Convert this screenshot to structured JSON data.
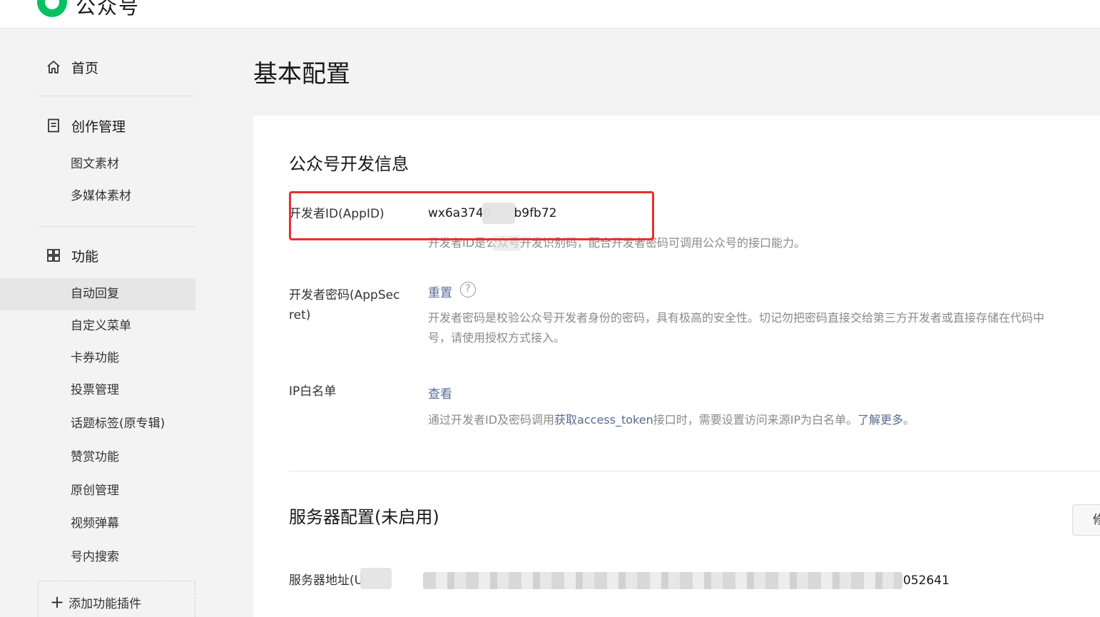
{
  "header": {
    "brand": "公众号"
  },
  "sidebar": {
    "home": "首页",
    "creation": {
      "label": "创作管理",
      "items": [
        "图文素材",
        "多媒体素材"
      ]
    },
    "features": {
      "label": "功能",
      "items": [
        "自动回复",
        "自定义菜单",
        "卡券功能",
        "投票管理",
        "话题标签(原专辑)",
        "赞赏功能",
        "原创管理",
        "视频弹幕",
        "号内搜索"
      ],
      "active_index": 0
    },
    "add_plugin": "添加功能插件"
  },
  "main": {
    "title": "基本配置",
    "dev_info": {
      "title": "公众号开发信息",
      "appid": {
        "label": "开发者ID(AppID)",
        "value_start": "wx6a3740",
        "value_end": "b9fb72",
        "desc": "开发者ID是公众号开发识别码，配合开发者密码可调用公众号的接口能力。"
      },
      "appsecret": {
        "label_line1": "开发者密码(AppSec",
        "label_line2": "ret)",
        "action": "重置",
        "help": "?",
        "desc_line1": "开发者密码是校验公众号开发者身份的密码，具有极高的安全性。切记勿把密码直接交给第三方开发者或直接存储在代码中",
        "desc_line2": "号，请使用授权方式接入。"
      },
      "ip_whitelist": {
        "label": "IP白名单",
        "action": "查看",
        "desc_prefix": "通过开发者ID及密码调用",
        "desc_link": "获取access_token",
        "desc_middle": "接口时，需要设置访问来源IP为白名单。",
        "desc_link2": "了解更多",
        "desc_suffix": "。"
      }
    },
    "server": {
      "title": "服务器配置(未启用)",
      "modify_button": "修",
      "address_label": "服务器地址(U",
      "address_tail": "052641"
    }
  }
}
